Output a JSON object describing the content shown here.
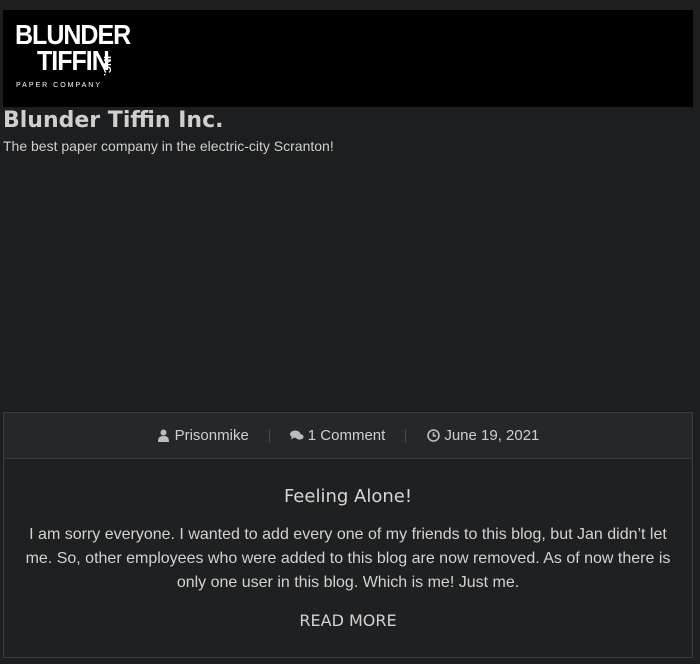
{
  "header": {
    "logo": {
      "line1": "BLUNDER",
      "line2": "TIFFIN",
      "inc": "INC.",
      "sub": "PAPER COMPANY"
    },
    "site_title": "Blunder Tiffin Inc.",
    "tagline": "The best paper company in the electric-city Scranton!"
  },
  "post": {
    "meta": {
      "author": "Prisonmike",
      "author_icon": "user-icon",
      "comments": "1 Comment",
      "comments_icon": "comments-icon",
      "date": "June 19, 2021",
      "date_icon": "clock-icon"
    },
    "title": "Feeling Alone!",
    "excerpt": "I am sorry everyone. I wanted to add every one of my friends to this blog, but Jan didn’t let me. So, other employees who were added to this blog are now removed. As of now there is only one user in this blog. Which is me! Just me.",
    "read_more": "READ MORE"
  },
  "colors": {
    "background": "#1c1e1f",
    "banner": "#000000",
    "card_meta_bg": "#25282a",
    "text": "#d2d2d2"
  }
}
